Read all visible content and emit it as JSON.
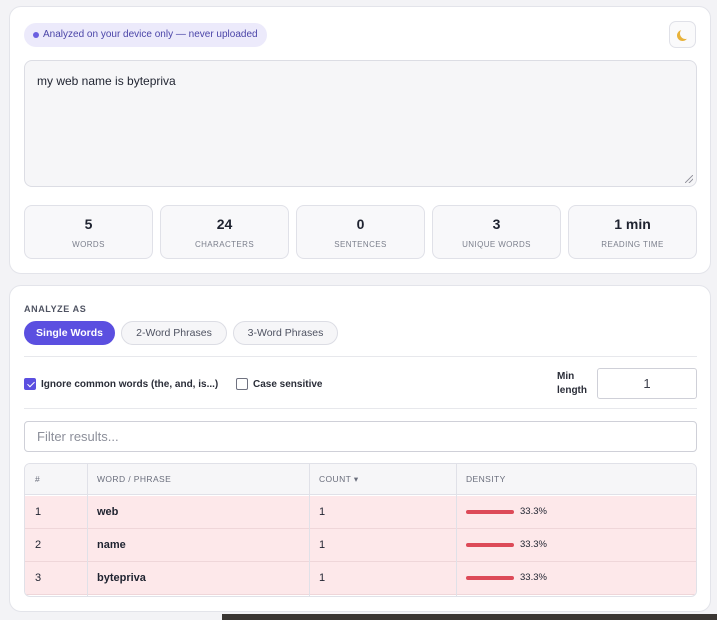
{
  "header": {
    "privacy_badge": "Analyzed on your device only — never uploaded",
    "theme_toggle_icon": "moon-icon"
  },
  "input": {
    "text": "my web name is bytepriva"
  },
  "stats": [
    {
      "value": "5",
      "label": "Words"
    },
    {
      "value": "24",
      "label": "Characters"
    },
    {
      "value": "0",
      "label": "Sentences"
    },
    {
      "value": "3",
      "label": "Unique words"
    },
    {
      "value": "1 min",
      "label": "Reading time"
    }
  ],
  "analyze": {
    "section_label": "ANALYZE AS",
    "modes": [
      {
        "label": "Single Words",
        "active": true
      },
      {
        "label": "2-Word Phrases",
        "active": false
      },
      {
        "label": "3-Word Phrases",
        "active": false
      }
    ]
  },
  "options": {
    "ignore_common_label": "Ignore common words (the, and, is...)",
    "ignore_common_checked": true,
    "case_sensitive_label": "Case sensitive",
    "case_sensitive_checked": false,
    "min_length_label": "Min length",
    "min_length_value": "1"
  },
  "filter": {
    "placeholder": "Filter results..."
  },
  "table": {
    "headers": [
      "#",
      "WORD / PHRASE",
      "COUNT ▾",
      "DENSITY"
    ],
    "rows": [
      {
        "rank": "1",
        "word": "web",
        "count": "1",
        "density": "33.3%",
        "density_value": 33.3
      },
      {
        "rank": "2",
        "word": "name",
        "count": "1",
        "density": "33.3%",
        "density_value": 33.3
      },
      {
        "rank": "3",
        "word": "bytepriva",
        "count": "1",
        "density": "33.3%",
        "density_value": 33.3
      }
    ]
  },
  "colors": {
    "accent": "#5b4fe0",
    "row_highlight": "#fde8ea",
    "density_bar": "#dd4a58"
  }
}
